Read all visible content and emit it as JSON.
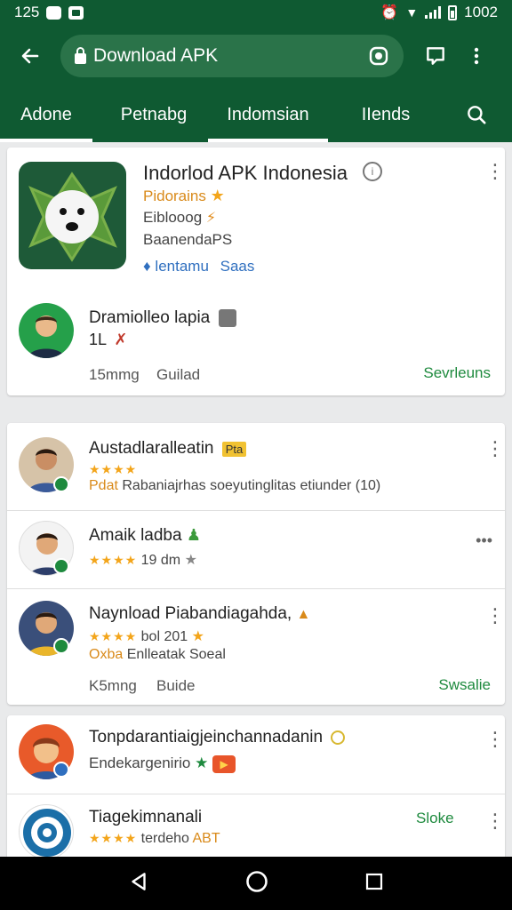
{
  "status_bar": {
    "time": "125",
    "right_time": "1002"
  },
  "app_bar": {
    "url_text": "Download APK"
  },
  "tabs": [
    {
      "label": "Adone",
      "active": true
    },
    {
      "label": "Petnabg",
      "active": false
    },
    {
      "label": "Indomsian",
      "active": true
    },
    {
      "label": "IIends",
      "active": false
    }
  ],
  "featured": {
    "title": "Indorlod APK Indonesia",
    "line1": "Pidorains",
    "line2": "Eiblooog",
    "line3": "BaanendaPS",
    "tag": "lentamu",
    "tag2": "Saas",
    "author_name": "Dramiolleo lapia",
    "author_sub": "1L",
    "footer_left": "15mmg",
    "footer_mid": "Guilad",
    "footer_action": "Sevrleuns"
  },
  "list_card": {
    "items": [
      {
        "name": "Austadlaralleatin",
        "badge": "Pta",
        "meta_prefix": "Pdat",
        "meta": "Rabaniajrhas soeyutinglitas etiunder (10)"
      },
      {
        "name": "Amaik ladba",
        "rating_text": "19 dm"
      },
      {
        "name": "Naynload Piabandiagahda,",
        "rating_text": "bol 201",
        "meta_prefix": "Oxba",
        "meta": "Enlleatak Soeal"
      }
    ],
    "footer_left": "K5mng",
    "footer_mid": "Buide",
    "footer_action": "Swsalie"
  },
  "bottom_card": {
    "items": [
      {
        "name": "Tonpdarantiaigjeinchannadanin",
        "sub": "Endekargenirio"
      },
      {
        "name": "Tiagekimnanali",
        "rating_text": "terdeho",
        "badge_text": "ABT",
        "action": "Sloke"
      }
    ]
  },
  "colors": {
    "primary": "#0f5a32",
    "accent": "#1e8a3e",
    "star": "#f3a51b",
    "tag_blue": "#2f6fbf"
  }
}
